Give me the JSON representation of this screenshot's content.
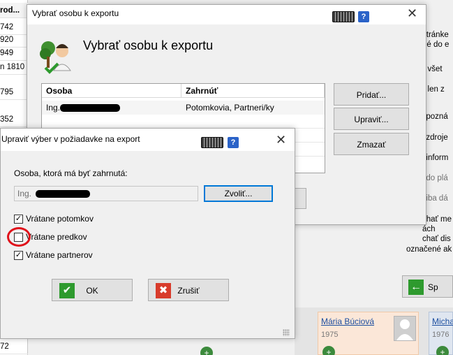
{
  "background": {
    "left_column": {
      "header": "rod...",
      "rows": [
        "742",
        "920",
        "949",
        "n 1810",
        "795",
        "352",
        "72"
      ]
    },
    "right_texts": [
      {
        "text": "stránke",
        "gray": false
      },
      {
        "text": "né do e",
        "gray": false
      },
      {
        "text": "ť všet",
        "gray": false
      },
      {
        "text": "ť len z",
        "gray": false
      },
      {
        "text": "' pozná",
        "gray": false
      },
      {
        "text": "' zdroje",
        "gray": false
      },
      {
        "text": "' inform",
        "gray": false
      },
      {
        "text": "' do plá",
        "gray": true
      },
      {
        "text": "' iba dá",
        "gray": true
      },
      {
        "text": "chať me",
        "gray": false
      },
      {
        "text": "ách",
        "gray": false
      },
      {
        "text": "chať dis",
        "gray": false
      }
    ],
    "bottom_text": "označené ak",
    "sp_button_label": "Sp",
    "cards": [
      {
        "name": "Mária Búciová",
        "year": "1975"
      },
      {
        "name": "Micha",
        "year": "1976"
      }
    ]
  },
  "main_dialog": {
    "title": "Vybrať osobu k exportu",
    "heading": "Vybrať osobu k exportu",
    "columns": [
      "Osoba",
      "Zahrnúť"
    ],
    "rows": [
      {
        "person": "Ing.",
        "include": "Potomkovia, Partneri/ky"
      }
    ],
    "buttons": {
      "add": "Pridať...",
      "edit": "Upraviť...",
      "delete": "Zmazať"
    }
  },
  "edit_dialog": {
    "title": "Upraviť výber v požiadavke na export",
    "person_label": "Osoba, ktorá má byť zahrnutá:",
    "person_value": "Ing.",
    "choose_button": "Zvoliť...",
    "checkboxes": [
      {
        "label": "Vrátane potomkov",
        "checked": true
      },
      {
        "label": "Vrátane predkov",
        "checked": false
      },
      {
        "label": "Vrátane partnerov",
        "checked": true
      }
    ],
    "ok_label": "OK",
    "cancel_label": "Zrušiť"
  },
  "colors": {
    "accent": "#0078d7",
    "annotation_red": "#e0111a",
    "ok_green": "#2e9a2e",
    "cancel_red": "#d83b2b"
  }
}
